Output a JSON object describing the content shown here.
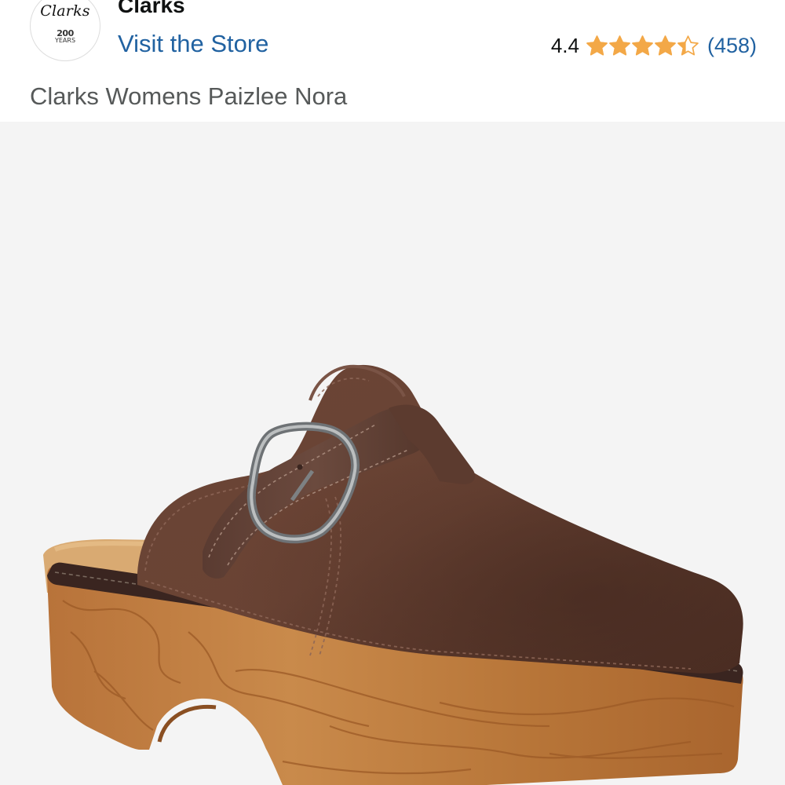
{
  "brand": {
    "logo_text": "Clarks",
    "logo_badge_number": "200",
    "logo_badge_text": "YEARS",
    "name": "Clarks",
    "store_link": "Visit the Store"
  },
  "rating": {
    "value": "4.4",
    "stars_out_of_5": 4.4,
    "star_color": "#f3a847",
    "count": "(458)"
  },
  "product": {
    "title": "Clarks Womens Paizlee Nora",
    "image_icon": "shoe-clog-image"
  },
  "colors": {
    "link": "#2162a1",
    "title_gray": "#565959",
    "image_background": "#f4f4f4"
  }
}
